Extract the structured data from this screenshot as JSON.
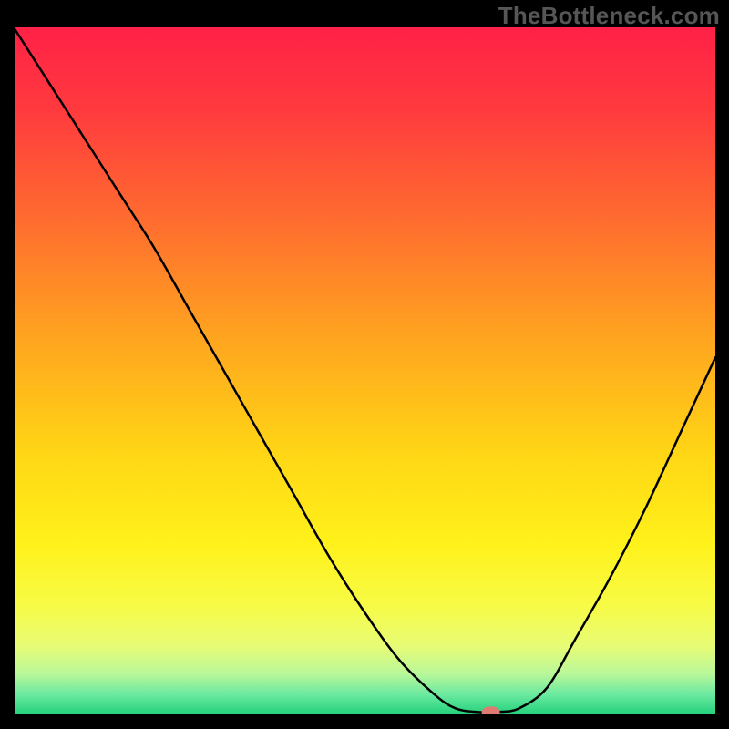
{
  "watermark": "TheBottleneck.com",
  "chart_data": {
    "type": "line",
    "title": "",
    "xlabel": "",
    "ylabel": "",
    "xlim": [
      0,
      100
    ],
    "ylim": [
      0,
      100
    ],
    "grid": false,
    "gradient_stops": [
      {
        "offset": 0.0,
        "color": "#ff2147"
      },
      {
        "offset": 0.12,
        "color": "#ff3a3e"
      },
      {
        "offset": 0.28,
        "color": "#ff6c2f"
      },
      {
        "offset": 0.45,
        "color": "#ffa41f"
      },
      {
        "offset": 0.62,
        "color": "#ffd615"
      },
      {
        "offset": 0.75,
        "color": "#fff11a"
      },
      {
        "offset": 0.84,
        "color": "#f7fb45"
      },
      {
        "offset": 0.9,
        "color": "#e7fc76"
      },
      {
        "offset": 0.94,
        "color": "#b8f79a"
      },
      {
        "offset": 0.97,
        "color": "#6ae9a0"
      },
      {
        "offset": 1.0,
        "color": "#1fd07a"
      }
    ],
    "series": [
      {
        "name": "curve",
        "x": [
          0,
          5,
          10,
          15,
          20,
          25,
          30,
          35,
          40,
          45,
          50,
          55,
          60,
          63,
          66,
          69,
          72,
          76,
          80,
          85,
          90,
          95,
          100
        ],
        "y": [
          100,
          92,
          84,
          76,
          68,
          59,
          50,
          41,
          32,
          23,
          15,
          8,
          3,
          1,
          0.5,
          0.5,
          1,
          4,
          11,
          20,
          30,
          41,
          52
        ]
      }
    ],
    "marker": {
      "x": 68,
      "y": 0.5,
      "color": "#df7b72",
      "rx": 10,
      "ry": 6
    },
    "axes_color": "#000000",
    "curve_color": "#000000",
    "curve_width": 2.5
  }
}
